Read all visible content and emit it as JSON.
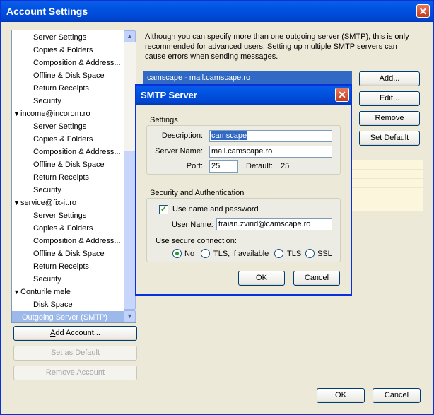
{
  "window": {
    "title": "Account Settings",
    "close_glyph": "✕"
  },
  "tree": {
    "items": [
      {
        "label": "Server Settings",
        "indent": 2
      },
      {
        "label": "Copies & Folders",
        "indent": 2
      },
      {
        "label": "Composition & Address...",
        "indent": 2
      },
      {
        "label": "Offline & Disk Space",
        "indent": 2
      },
      {
        "label": "Return Receipts",
        "indent": 2
      },
      {
        "label": "Security",
        "indent": 2
      },
      {
        "label": "income@incorom.ro",
        "indent": 1,
        "expander": "▼"
      },
      {
        "label": "Server Settings",
        "indent": 2
      },
      {
        "label": "Copies & Folders",
        "indent": 2
      },
      {
        "label": "Composition & Address...",
        "indent": 2
      },
      {
        "label": "Offline & Disk Space",
        "indent": 2
      },
      {
        "label": "Return Receipts",
        "indent": 2
      },
      {
        "label": "Security",
        "indent": 2
      },
      {
        "label": "service@fix-it.ro",
        "indent": 1,
        "expander": "▼"
      },
      {
        "label": "Server Settings",
        "indent": 2
      },
      {
        "label": "Copies & Folders",
        "indent": 2
      },
      {
        "label": "Composition & Address...",
        "indent": 2
      },
      {
        "label": "Offline & Disk Space",
        "indent": 2
      },
      {
        "label": "Return Receipts",
        "indent": 2
      },
      {
        "label": "Security",
        "indent": 2
      },
      {
        "label": "Conturile mele",
        "indent": 1,
        "expander": "▼"
      },
      {
        "label": "Disk Space",
        "indent": 2
      },
      {
        "label": "Outgoing Server (SMTP)",
        "indent": 1,
        "selected": true
      }
    ]
  },
  "left_buttons": {
    "add_account": "Add Account...",
    "set_default": "Set as Default",
    "remove_account": "Remove Account"
  },
  "main": {
    "description": "Although you can specify more than one outgoing server (SMTP), this is only recommended for advanced users. Setting up multiple SMTP servers can cause errors when sending messages.",
    "server_list": [
      "camscape - mail.camscape.ro"
    ],
    "add": "Add...",
    "edit": "Edit...",
    "remove": "Remove",
    "set_default": "Set Default"
  },
  "footer": {
    "ok": "OK",
    "cancel": "Cancel"
  },
  "smtp_dialog": {
    "title": "SMTP Server",
    "settings_label": "Settings",
    "description_label": "Description:",
    "description_value": "camscape",
    "server_name_label": "Server Name:",
    "server_name_value": "mail.camscape.ro",
    "port_label": "Port:",
    "port_value": "25",
    "default_label": "Default:",
    "default_value": "25",
    "security_label": "Security and Authentication",
    "use_name_label": "Use name and password",
    "use_name_checked": true,
    "user_name_label": "User Name:",
    "user_name_value": "traian.zvirid@camscape.ro",
    "secure_label": "Use secure connection:",
    "options": [
      "No",
      "TLS, if available",
      "TLS",
      "SSL"
    ],
    "selected_option": "No",
    "ok": "OK",
    "cancel": "Cancel"
  },
  "colors": {
    "title_bar": "#0053e0",
    "selection": "#316ac5",
    "check": "#21a121"
  }
}
